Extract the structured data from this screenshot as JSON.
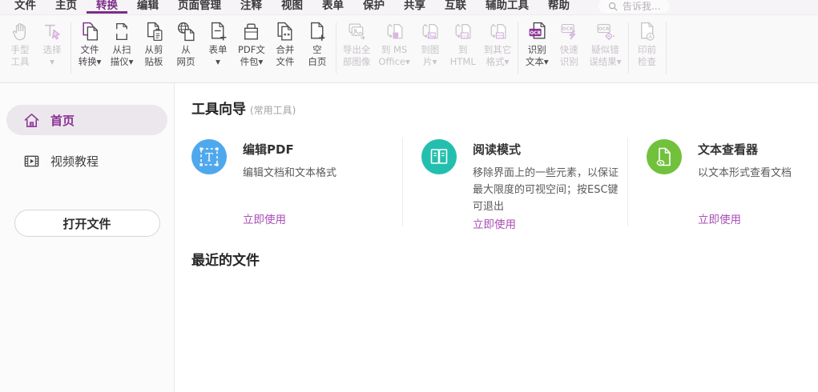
{
  "colors": {
    "accent_purple": "#7b2d87",
    "link_purple": "#a94fb5",
    "card_blue": "#4fa8ec",
    "card_teal": "#23bfae",
    "card_green": "#72c13d"
  },
  "menubar": {
    "items": [
      {
        "label": "文件"
      },
      {
        "label": "主页"
      },
      {
        "label": "转换",
        "active": true
      },
      {
        "label": "编辑"
      },
      {
        "label": "页面管理"
      },
      {
        "label": "注释"
      },
      {
        "label": "视图"
      },
      {
        "label": "表单"
      },
      {
        "label": "保护"
      },
      {
        "label": "共享"
      },
      {
        "label": "互联"
      },
      {
        "label": "辅助工具"
      },
      {
        "label": "帮助"
      }
    ],
    "search_label": "告诉我..."
  },
  "ribbon": {
    "groups": [
      {
        "items": [
          {
            "label": "手型\n工具",
            "icon": "hand-tool-icon",
            "disabled": true
          },
          {
            "label": "选择\n▾",
            "icon": "select-tool-icon",
            "disabled": true
          }
        ]
      },
      {
        "items": [
          {
            "label": "文件\n转换▾",
            "icon": "file-convert-icon",
            "disabled": false
          },
          {
            "label": "从扫\n描仪▾",
            "icon": "from-scanner-icon",
            "disabled": false
          },
          {
            "label": "从剪\n贴板",
            "icon": "from-clipboard-icon",
            "disabled": false
          },
          {
            "label": "从\n网页",
            "icon": "from-web-icon",
            "disabled": false
          },
          {
            "label": "表单\n▾",
            "icon": "form-icon",
            "disabled": false
          },
          {
            "label": "PDF文\n件包▾",
            "icon": "pdf-portfolio-icon",
            "disabled": false
          },
          {
            "label": "合并\n文件",
            "icon": "merge-files-icon",
            "disabled": false
          },
          {
            "label": "空\n白页",
            "icon": "blank-page-icon",
            "disabled": false
          }
        ]
      },
      {
        "items": [
          {
            "label": "导出全\n部图像",
            "icon": "export-all-images-icon",
            "disabled": true
          },
          {
            "label": "到 MS\nOffice▾",
            "icon": "to-ms-office-icon",
            "disabled": true
          },
          {
            "label": "到图\n片▾",
            "icon": "to-image-icon",
            "disabled": true
          },
          {
            "label": "到\nHTML",
            "icon": "to-html-icon",
            "disabled": true
          },
          {
            "label": "到其它\n格式▾",
            "icon": "to-other-format-icon",
            "disabled": true
          }
        ]
      },
      {
        "items": [
          {
            "label": "识别\n文本▾",
            "icon": "ocr-text-icon",
            "disabled": false
          },
          {
            "label": "快速\n识别",
            "icon": "ocr-quick-icon",
            "disabled": true
          },
          {
            "label": "疑似错\n误结果▾",
            "icon": "ocr-suspect-icon",
            "disabled": true
          }
        ]
      },
      {
        "items": [
          {
            "label": "印前\n检查",
            "icon": "preflight-icon",
            "disabled": true
          }
        ]
      }
    ]
  },
  "sidebar": {
    "items": [
      {
        "label": "首页",
        "icon": "home-icon",
        "active": true
      },
      {
        "label": "视频教程",
        "icon": "video-tutorial-icon",
        "active": false
      }
    ],
    "open_file_label": "打开文件"
  },
  "main": {
    "tools_title": "工具向导",
    "tools_sub": "(常用工具)",
    "cards": [
      {
        "title": "编辑PDF",
        "description": "编辑文档和文本格式",
        "action": "立即使用",
        "icon": "edit-pdf-icon",
        "color": "#4fa8ec"
      },
      {
        "title": "阅读模式",
        "description": "移除界面上的一些元素，以保证最大限度的可视空间；按ESC键可退出",
        "action": "立即使用",
        "icon": "reading-mode-icon",
        "color": "#23bfae"
      },
      {
        "title": "文本查看器",
        "description": "以文本形式查看文档",
        "action": "立即使用",
        "icon": "text-viewer-icon",
        "color": "#72c13d"
      }
    ],
    "recent_title": "最近的文件"
  }
}
